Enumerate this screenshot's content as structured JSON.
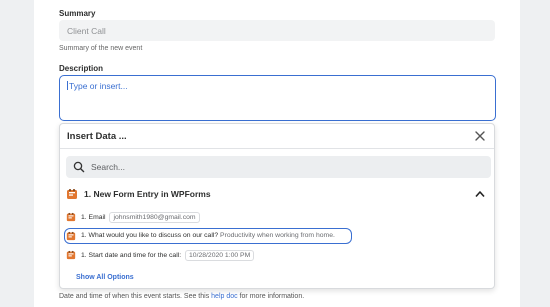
{
  "summary": {
    "label": "Summary",
    "value": "Client Call",
    "hint": "Summary of the new event"
  },
  "description": {
    "label": "Description",
    "placeholder": "Type or insert..."
  },
  "insert_panel": {
    "title": "Insert Data ...",
    "search_placeholder": "Search...",
    "section_title": "1. New Form Entry in WPForms",
    "items": [
      {
        "label": "1. Email",
        "value": "johnsmith1980@gmail.com"
      },
      {
        "label": "1. What would you like to discuss on our call?",
        "value": "Productivity when working from home."
      },
      {
        "label": "1. Start date and time for the call:",
        "value": "10/28/2020 1:00 PM"
      }
    ],
    "show_all": "Show All Options"
  },
  "footer": {
    "prefix": "Date and time of when this event starts. See this",
    "link": "help doc",
    "suffix": "for more information."
  },
  "colors": {
    "accent": "#3a6fd1",
    "app_icon": "#e27730"
  },
  "icons": {
    "close": "close-icon",
    "search": "search-icon",
    "app": "wpforms-icon",
    "collapse": "chevron-up-icon"
  }
}
